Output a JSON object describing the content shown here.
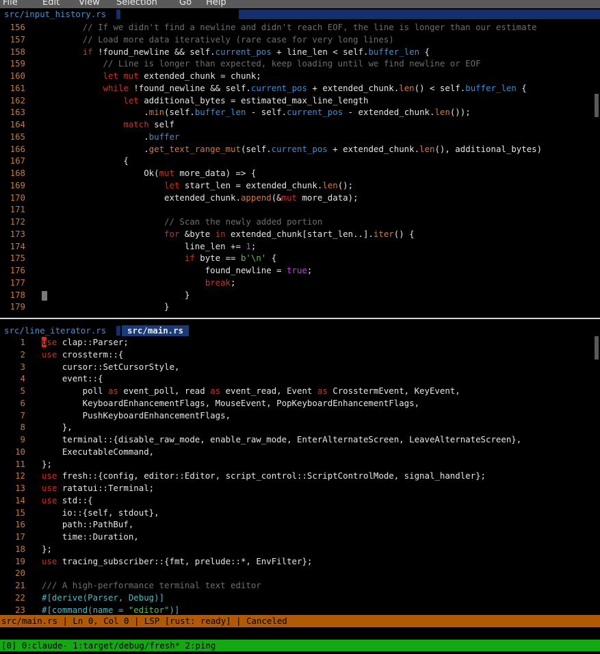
{
  "menu": {
    "file": "File",
    "edit": "Edit",
    "view": "View",
    "selection": "Selection",
    "go": "Go",
    "help": "Help"
  },
  "top_pane": {
    "tab": "src/input_history.rs"
  },
  "bottom_pane": {
    "tab_inactive": "src/line_iterator.rs",
    "tab_active": "src/main.rs"
  },
  "status_bar": "src/main.rs | Ln 0, Col 0 | LSP [rust: ready] | Canceled",
  "tmux_bar": "[0] 0:claude- 1:target/debug/fresh* 2:ping",
  "colors": {
    "menubar_bg": "#5a5a5a",
    "tab_active_bg": "#1a3a78",
    "statusbar_bg": "#b05a06",
    "tmux_bg": "#15a815",
    "keyword": "#d72e1e",
    "line_number": "#c87a3a"
  }
}
